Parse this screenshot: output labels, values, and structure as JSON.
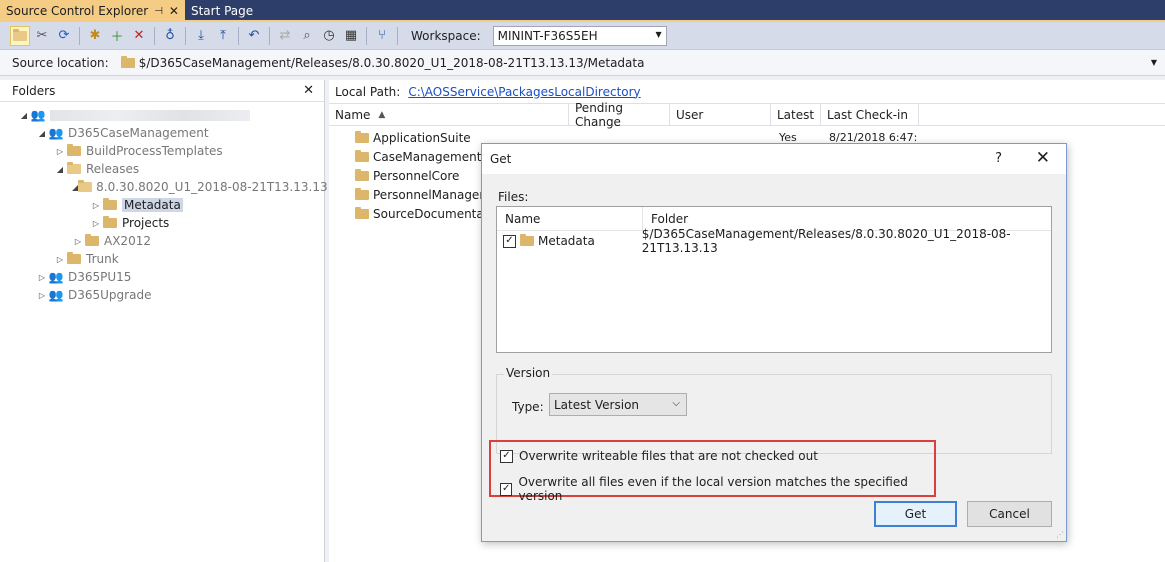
{
  "tabs": [
    {
      "label": "Source Control Explorer",
      "active": true
    },
    {
      "label": "Start Page",
      "active": false
    }
  ],
  "toolbar": {
    "workspace_label": "Workspace:",
    "workspace_value": "MININT-F36S5EH"
  },
  "source_location": {
    "label": "Source location:",
    "path": "$/D365CaseManagement/Releases/8.0.30.8020_U1_2018-08-21T13.13.13/Metadata"
  },
  "folders": {
    "title": "Folders",
    "tree": [
      {
        "label": "D365CaseManagement",
        "level": 1,
        "kind": "team",
        "expanded": true,
        "gray": true
      },
      {
        "label": "BuildProcessTemplates",
        "level": 2,
        "kind": "folder",
        "expanded": false,
        "gray": true
      },
      {
        "label": "Releases",
        "level": 2,
        "kind": "folder-open",
        "expanded": true,
        "gray": true
      },
      {
        "label": "8.0.30.8020_U1_2018-08-21T13.13.13",
        "level": 3,
        "kind": "folder-open",
        "expanded": true,
        "gray": true
      },
      {
        "label": "Metadata",
        "level": 4,
        "kind": "folder",
        "expanded": false,
        "gray": false,
        "selected": true
      },
      {
        "label": "Projects",
        "level": 4,
        "kind": "folder",
        "expanded": false,
        "gray": false
      },
      {
        "label": "AX2012",
        "level": 3,
        "kind": "folder",
        "expanded": false,
        "gray": true
      },
      {
        "label": "Trunk",
        "level": 2,
        "kind": "folder",
        "expanded": false,
        "gray": true
      },
      {
        "label": "D365PU15",
        "level": 1,
        "kind": "team",
        "expanded": false,
        "gray": true
      },
      {
        "label": "D365Upgrade",
        "level": 1,
        "kind": "team",
        "expanded": false,
        "gray": true
      }
    ]
  },
  "right": {
    "local_path_label": "Local Path:",
    "local_path_value": "C:\\AOSService\\PackagesLocalDirectory",
    "columns": [
      "Name",
      "Pending Change",
      "User",
      "Latest",
      "Last Check-in"
    ],
    "files": [
      {
        "name": "ApplicationSuite",
        "latest": "Yes",
        "checkin": "8/21/2018 6:47:"
      },
      {
        "name": "CaseManagement"
      },
      {
        "name": "PersonnelCore"
      },
      {
        "name": "PersonnelManageme"
      },
      {
        "name": "SourceDocumentatio"
      }
    ]
  },
  "dialog": {
    "title": "Get",
    "help": "?",
    "files_label": "Files:",
    "list_columns": [
      "Name",
      "Folder"
    ],
    "list_rows": [
      {
        "name": "Metadata",
        "folder": "$/D365CaseManagement/Releases/8.0.30.8020_U1_2018-08-21T13.13.13",
        "checked": true
      }
    ],
    "version_legend": "Version",
    "type_label": "Type:",
    "type_value": "Latest Version",
    "options": [
      {
        "label": "Overwrite writeable files that are not checked out",
        "checked": true
      },
      {
        "label": "Overwrite all files even if the local version matches the specified version",
        "checked": true
      }
    ],
    "get_button": "Get",
    "cancel_button": "Cancel"
  }
}
